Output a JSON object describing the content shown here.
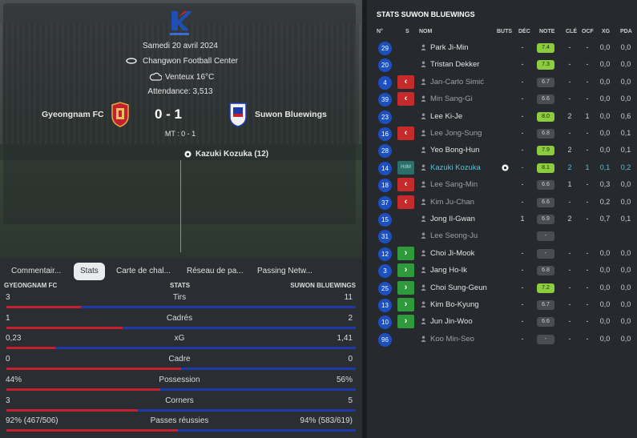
{
  "match": {
    "date": "Samedi 20 avril 2024",
    "stadium": "Changwon Football Center",
    "weather": "Venteux 16°C",
    "attendance": "Attendance: 3,513",
    "home": "Gyeongnam FC",
    "away": "Suwon Bluewings",
    "score": "0 - 1",
    "halftime": "MT : 0 - 1",
    "scorer": "Kazuki Kozuka (12)"
  },
  "tabs": [
    "Commentair...",
    "Stats",
    "Carte de chal...",
    "Réseau de pa...",
    "Passing Netw..."
  ],
  "stats_header": {
    "home": "GYEONGNAM FC",
    "mid": "STATS",
    "away": "SUWON BLUEWINGS"
  },
  "stats": [
    {
      "label": "Tirs",
      "home": "3",
      "away": "11",
      "home_share": 0.214
    },
    {
      "label": "Cadrés",
      "home": "1",
      "away": "2",
      "home_share": 0.333
    },
    {
      "label": "xG",
      "home": "0,23",
      "away": "1,41",
      "home_share": 0.14
    },
    {
      "label": "Cadre",
      "home": "0",
      "away": "0",
      "home_share": 0.5
    },
    {
      "label": "Possession",
      "home": "44%",
      "away": "56%",
      "home_share": 0.44
    },
    {
      "label": "Corners",
      "home": "3",
      "away": "5",
      "home_share": 0.375
    },
    {
      "label": "Passes réussies",
      "home": "92% (467/506)",
      "away": "94% (583/619)",
      "home_share": 0.49
    }
  ],
  "right": {
    "title": "STATS SUWON BLUEWINGS",
    "cols": [
      "N°",
      "S",
      "NOM",
      "BUTS",
      "DÉC",
      "NOTE",
      "CLÉ",
      "OCF",
      "XG",
      "PDA"
    ],
    "players": [
      {
        "n": "29",
        "sub": "",
        "name": "Park Ji-Min",
        "buts": "",
        "dec": "-",
        "note": "7.4",
        "note_style": "g",
        "cle": "-",
        "ocf": "-",
        "xg": "0,0",
        "pda": "0,0",
        "dim": false,
        "hi": false,
        "goal": false
      },
      {
        "n": "20",
        "sub": "",
        "name": "Tristan Dekker",
        "buts": "",
        "dec": "-",
        "note": "7.3",
        "note_style": "g",
        "cle": "-",
        "ocf": "-",
        "xg": "0,0",
        "pda": "0,0",
        "dim": false,
        "hi": false,
        "goal": false
      },
      {
        "n": "4",
        "sub": "out",
        "name": "Jan-Carlo Simić",
        "buts": "",
        "dec": "-",
        "note": "6.7",
        "note_style": "",
        "cle": "-",
        "ocf": "-",
        "xg": "0,0",
        "pda": "0,0",
        "dim": true,
        "hi": false,
        "goal": false
      },
      {
        "n": "39",
        "sub": "out",
        "name": "Min Sang-Gi",
        "buts": "",
        "dec": "-",
        "note": "6.6",
        "note_style": "",
        "cle": "-",
        "ocf": "-",
        "xg": "0,0",
        "pda": "0,0",
        "dim": true,
        "hi": false,
        "goal": false
      },
      {
        "n": "23",
        "sub": "",
        "name": "Lee Ki-Je",
        "buts": "",
        "dec": "-",
        "note": "8.0",
        "note_style": "g",
        "cle": "2",
        "ocf": "1",
        "xg": "0,0",
        "pda": "0,6",
        "dim": false,
        "hi": false,
        "goal": false
      },
      {
        "n": "16",
        "sub": "out",
        "name": "Lee Jong-Sung",
        "buts": "",
        "dec": "-",
        "note": "6.8",
        "note_style": "",
        "cle": "-",
        "ocf": "-",
        "xg": "0,0",
        "pda": "0,1",
        "dim": true,
        "hi": false,
        "goal": false
      },
      {
        "n": "28",
        "sub": "",
        "name": "Yeo Bong-Hun",
        "buts": "",
        "dec": "-",
        "note": "7.9",
        "note_style": "g",
        "cle": "2",
        "ocf": "-",
        "xg": "0,0",
        "pda": "0,1",
        "dim": false,
        "hi": false,
        "goal": false
      },
      {
        "n": "14",
        "sub": "pos",
        "pos": "HdM",
        "name": "Kazuki Kozuka",
        "buts": "",
        "dec": "-",
        "note": "8.1",
        "note_style": "g",
        "cle": "2",
        "ocf": "1",
        "xg": "0,1",
        "pda": "0,2",
        "dim": false,
        "hi": true,
        "goal": true
      },
      {
        "n": "18",
        "sub": "out",
        "name": "Lee Sang-Min",
        "buts": "",
        "dec": "-",
        "note": "6.6",
        "note_style": "",
        "cle": "1",
        "ocf": "-",
        "xg": "0,3",
        "pda": "0,0",
        "dim": true,
        "hi": false,
        "goal": false
      },
      {
        "n": "37",
        "sub": "out",
        "name": "Kim Ju-Chan",
        "buts": "",
        "dec": "-",
        "note": "6.6",
        "note_style": "",
        "cle": "-",
        "ocf": "-",
        "xg": "0,2",
        "pda": "0,0",
        "dim": true,
        "hi": false,
        "goal": false
      },
      {
        "n": "15",
        "sub": "",
        "name": "Jong Il-Gwan",
        "buts": "",
        "dec": "1",
        "note": "6.9",
        "note_style": "",
        "cle": "2",
        "ocf": "-",
        "xg": "0,7",
        "pda": "0,1",
        "dim": false,
        "hi": false,
        "goal": false
      },
      {
        "n": "31",
        "sub": "",
        "name": "Lee Seong-Ju",
        "buts": "",
        "dec": "",
        "note": "-",
        "note_style": "",
        "cle": "",
        "ocf": "",
        "xg": "",
        "pda": "",
        "dim": true,
        "hi": false,
        "goal": false
      },
      {
        "n": "12",
        "sub": "in",
        "name": "Choi Ji-Mook",
        "buts": "",
        "dec": "-",
        "note": "-",
        "note_style": "",
        "cle": "-",
        "ocf": "-",
        "xg": "0,0",
        "pda": "0,0",
        "dim": false,
        "hi": false,
        "goal": false
      },
      {
        "n": "3",
        "sub": "in",
        "name": "Jang Ho-Ik",
        "buts": "",
        "dec": "-",
        "note": "6.8",
        "note_style": "",
        "cle": "-",
        "ocf": "-",
        "xg": "0,0",
        "pda": "0,0",
        "dim": false,
        "hi": false,
        "goal": false
      },
      {
        "n": "25",
        "sub": "in",
        "name": "Choi Sung-Geun",
        "buts": "",
        "dec": "-",
        "note": "7.2",
        "note_style": "g",
        "cle": "-",
        "ocf": "-",
        "xg": "0,0",
        "pda": "0,0",
        "dim": false,
        "hi": false,
        "goal": false
      },
      {
        "n": "13",
        "sub": "in",
        "name": "Kim Bo-Kyung",
        "buts": "",
        "dec": "-",
        "note": "6.7",
        "note_style": "",
        "cle": "-",
        "ocf": "-",
        "xg": "0,0",
        "pda": "0,0",
        "dim": false,
        "hi": false,
        "goal": false
      },
      {
        "n": "10",
        "sub": "in",
        "name": "Jun Jin-Woo",
        "buts": "",
        "dec": "-",
        "note": "6.6",
        "note_style": "",
        "cle": "-",
        "ocf": "-",
        "xg": "0,0",
        "pda": "0,0",
        "dim": false,
        "hi": false,
        "goal": false
      },
      {
        "n": "96",
        "sub": "",
        "name": "Koo Min-Seo",
        "buts": "",
        "dec": "-",
        "note": "-",
        "note_style": "",
        "cle": "-",
        "ocf": "-",
        "xg": "0,0",
        "pda": "0,0",
        "dim": true,
        "hi": false,
        "goal": false
      }
    ]
  },
  "colors": {
    "home": "#c4212f",
    "away": "#1f3aa8",
    "rating_good": "#8ccc3f",
    "sub_out": "#c62b2b",
    "sub_in": "#2f9a3c"
  }
}
